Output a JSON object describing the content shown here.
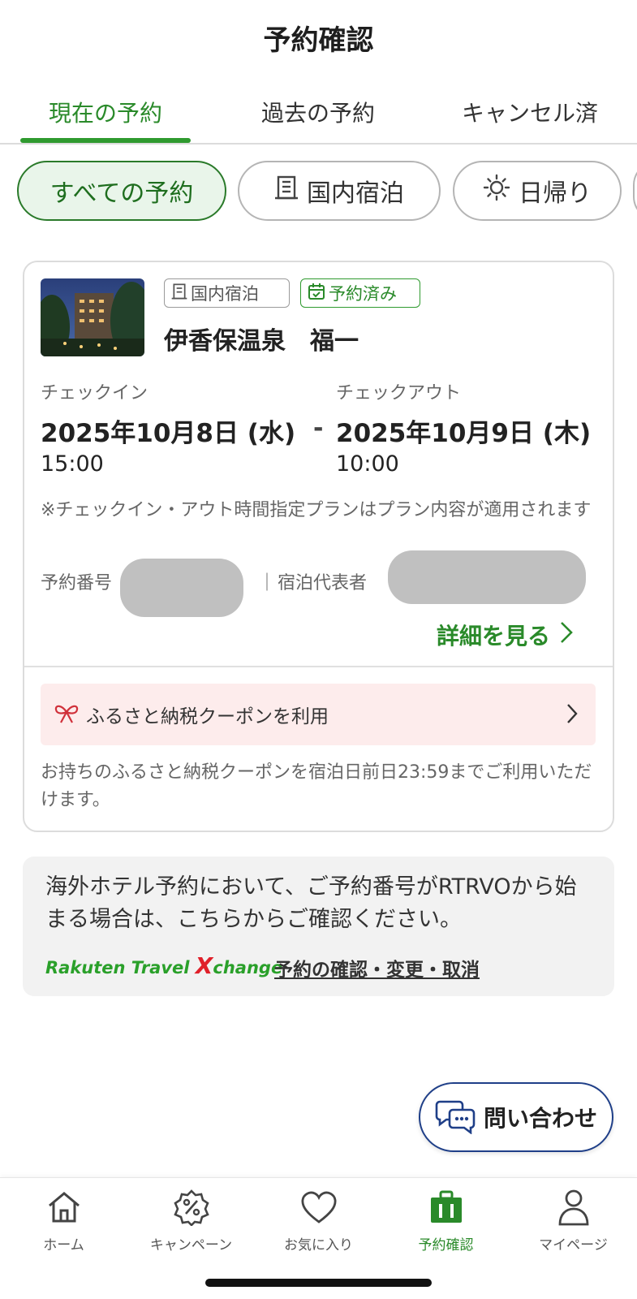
{
  "header": {
    "title": "予約確認"
  },
  "tabs": [
    {
      "label": "現在の予約",
      "active": true
    },
    {
      "label": "過去の予約",
      "active": false
    },
    {
      "label": "キャンセル済",
      "active": false
    }
  ],
  "filters": [
    {
      "label": "すべての予約",
      "active": true,
      "icon": ""
    },
    {
      "label": "国内宿泊",
      "active": false,
      "icon": "building-icon"
    },
    {
      "label": "日帰り",
      "active": false,
      "icon": "sun-icon"
    }
  ],
  "reservation": {
    "type_tag": "国内宿泊",
    "status_tag": "予約済み",
    "hotel_name": "伊香保温泉　福一",
    "checkin_label": "チェックイン",
    "checkin_date": "2025年10月8日 (水)",
    "checkin_time": "15:00",
    "separator": "-",
    "checkout_label": "チェックアウト",
    "checkout_date": "2025年10月9日 (木)",
    "checkout_time": "10:00",
    "note": "※チェックイン・アウト時間指定プランはプラン内容が適用されます",
    "reservation_number_label": "予約番号",
    "divider": "｜",
    "guest_label": "宿泊代表者",
    "detail_link": "詳細を見る",
    "coupon_label": "ふるさと納税クーポンを利用",
    "coupon_note": "お持ちのふるさと納税クーポンを宿泊日前日23:59までご利用いただけます。"
  },
  "overseas": {
    "text": "海外ホテル予約において、ご予約番号がRTRVOから始まる場合は、こちらからご確認ください。",
    "logo_text": "Rakuten Travel ",
    "logo_x": "X",
    "logo_suffix": "change",
    "link": "予約の確認・変更・取消"
  },
  "contact_button": {
    "label": "問い合わせ"
  },
  "bottom_nav": [
    {
      "label": "ホーム",
      "icon": "home-icon",
      "active": false
    },
    {
      "label": "キャンペーン",
      "icon": "percent-badge-icon",
      "active": false
    },
    {
      "label": "お気に入り",
      "icon": "heart-icon",
      "active": false
    },
    {
      "label": "予約確認",
      "icon": "suitcase-icon",
      "active": true
    },
    {
      "label": "マイページ",
      "icon": "person-icon",
      "active": false
    }
  ],
  "colors": {
    "brand_green": "#2a8a2a",
    "coupon_bg": "#fdecec",
    "contact_border": "#1f3f88"
  }
}
